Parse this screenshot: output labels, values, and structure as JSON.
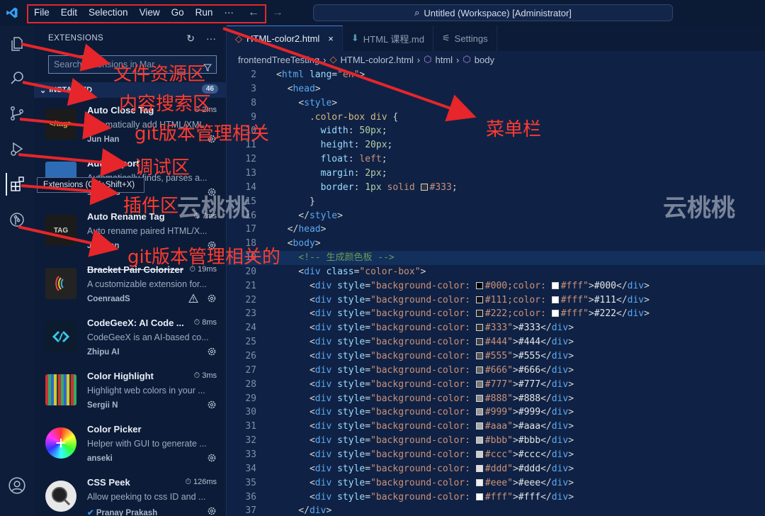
{
  "window": {
    "menu": [
      "File",
      "Edit",
      "Selection",
      "View",
      "Go",
      "Run",
      "···"
    ],
    "command_center": "Untitled (Workspace) [Administrator]"
  },
  "sidebar": {
    "title": "EXTENSIONS",
    "search_placeholder": "Search Extensions in Mar",
    "section_label": "INSTALLED",
    "section_count": "46",
    "tooltip": "Extensions (Ctrl+Shift+X)",
    "extensions": [
      {
        "name": "Auto Close Tag",
        "time": "2ms",
        "desc": "Automatically add HTML/XML",
        "author": "Jun Han",
        "icon_text": "</tag>",
        "icon_color": "#1a1a1a"
      },
      {
        "name": "Auto Import",
        "time": "",
        "desc": "Automatically finds, parses a...",
        "author": "steoates",
        "icon_text": "",
        "icon_color": "#2d6bb5"
      },
      {
        "name": "Auto Rename Tag",
        "time": "7ms",
        "desc": "Auto rename paired HTML/X...",
        "author": "Jun Han",
        "icon_text": "TAG",
        "icon_color": "#1a1a1a"
      },
      {
        "name": "Bracket Pair Colorizer",
        "time": "19ms",
        "desc": "A customizable extension for...",
        "author": "CoenraadS",
        "icon_text": "",
        "icon_color": "#222"
      },
      {
        "name": "CodeGeeX: AI Code ...",
        "time": "8ms",
        "desc": "CodeGeeX is an AI-based co...",
        "author": "Zhipu AI",
        "icon_text": "",
        "icon_color": "#0d1b2e"
      },
      {
        "name": "Color Highlight",
        "time": "3ms",
        "desc": "Highlight web colors in your ...",
        "author": "Sergii N",
        "icon_text": "",
        "icon_color": "#333"
      },
      {
        "name": "Color Picker",
        "time": "",
        "desc": "Helper with GUI to generate ...",
        "author": "anseki",
        "icon_text": "",
        "icon_color": "#fff"
      },
      {
        "name": "CSS Peek",
        "time": "126ms",
        "desc": "Allow peeking to css ID and ...",
        "author": "Pranay Prakash",
        "icon_text": "",
        "icon_color": "#eee"
      }
    ]
  },
  "tabs": [
    {
      "label": "HTML-color2.html",
      "active": true
    },
    {
      "label": "HTML 课程.md",
      "active": false
    },
    {
      "label": "Settings",
      "active": false
    }
  ],
  "breadcrumb": [
    "frontendTreeTesting",
    "HTML-color2.html",
    "html",
    "body"
  ],
  "annotations": {
    "menu_bar": "菜单栏",
    "explorer": "文件资源区",
    "search": "内容搜索区",
    "git": "git版本管理相关",
    "debug": "调试区",
    "extensions": "插件区",
    "git2": "git版本管理相关的",
    "watermark": "云桃桃"
  },
  "code_lines": [
    {
      "n": "2",
      "parts": [
        [
          "t-pun",
          "<"
        ],
        [
          "t-tag",
          "html "
        ],
        [
          "t-attr",
          "lang"
        ],
        [
          "t-pun",
          "="
        ],
        [
          "t-str",
          "\"en\""
        ],
        [
          "t-pun",
          ">"
        ]
      ]
    },
    {
      "n": "3",
      "parts": [
        [
          "t-pun",
          "  <"
        ],
        [
          "t-tag",
          "head"
        ],
        [
          "t-pun",
          ">"
        ]
      ]
    },
    {
      "n": "8",
      "parts": [
        [
          "t-pun",
          "    <"
        ],
        [
          "t-tag",
          "style"
        ],
        [
          "t-pun",
          ">"
        ]
      ]
    },
    {
      "n": "9",
      "parts": [
        [
          "t-sel",
          "      .color-box div "
        ],
        [
          "t-pun",
          "{"
        ]
      ]
    },
    {
      "n": "10",
      "parts": [
        [
          "t-prop",
          "        width"
        ],
        [
          "t-pun",
          ": "
        ],
        [
          "t-num",
          "50px"
        ],
        [
          "t-pun",
          ";"
        ]
      ]
    },
    {
      "n": "11",
      "parts": [
        [
          "t-prop",
          "        height"
        ],
        [
          "t-pun",
          ": "
        ],
        [
          "t-num",
          "20px"
        ],
        [
          "t-pun",
          ";"
        ]
      ]
    },
    {
      "n": "12",
      "parts": [
        [
          "t-prop",
          "        float"
        ],
        [
          "t-pun",
          ": "
        ],
        [
          "t-val",
          "left"
        ],
        [
          "t-pun",
          ";"
        ]
      ]
    },
    {
      "n": "13",
      "parts": [
        [
          "t-prop",
          "        margin"
        ],
        [
          "t-pun",
          ": "
        ],
        [
          "t-num",
          "2px"
        ],
        [
          "t-pun",
          ";"
        ]
      ]
    },
    {
      "n": "14",
      "parts": [
        [
          "t-prop",
          "        border"
        ],
        [
          "t-pun",
          ": "
        ],
        [
          "t-num",
          "1px "
        ],
        [
          "t-val",
          "solid "
        ],
        [
          "sw",
          "#333"
        ],
        [
          "t-val",
          "#333"
        ],
        [
          "t-pun",
          ";"
        ]
      ]
    },
    {
      "n": "15",
      "parts": [
        [
          "t-pun",
          "      }"
        ]
      ]
    },
    {
      "n": "16",
      "parts": [
        [
          "t-pun",
          "    </"
        ],
        [
          "t-tag",
          "style"
        ],
        [
          "t-pun",
          ">"
        ]
      ]
    },
    {
      "n": "17",
      "parts": [
        [
          "t-pun",
          "  </"
        ],
        [
          "t-tag",
          "head"
        ],
        [
          "t-pun",
          ">"
        ]
      ]
    },
    {
      "n": "18",
      "parts": [
        [
          "t-pun",
          "  <"
        ],
        [
          "t-tag",
          "body"
        ],
        [
          "t-pun",
          ">"
        ]
      ]
    },
    {
      "n": "19",
      "hl": true,
      "parts": [
        [
          "t-com",
          "    <!-- 生成颜色板 -->"
        ]
      ]
    },
    {
      "n": "20",
      "parts": [
        [
          "t-pun",
          "    <"
        ],
        [
          "t-tag",
          "div "
        ],
        [
          "t-attr",
          "class"
        ],
        [
          "t-pun",
          "="
        ],
        [
          "t-str",
          "\"color-box\""
        ],
        [
          "t-pun",
          ">"
        ]
      ]
    },
    {
      "n": "21",
      "parts": [
        [
          "t-pun",
          "      <"
        ],
        [
          "t-tag",
          "div "
        ],
        [
          "t-attr",
          "style"
        ],
        [
          "t-pun",
          "="
        ],
        [
          "t-str",
          "\"background-color: "
        ],
        [
          "sw",
          "#000"
        ],
        [
          "t-str",
          "#000;color: "
        ],
        [
          "sw",
          "#fff"
        ],
        [
          "t-str",
          "#fff\""
        ],
        [
          "t-pun",
          ">"
        ],
        [
          "t-txt",
          "#000"
        ],
        [
          "t-pun",
          "</"
        ],
        [
          "t-tag",
          "div"
        ],
        [
          "t-pun",
          ">"
        ]
      ]
    },
    {
      "n": "22",
      "parts": [
        [
          "t-pun",
          "      <"
        ],
        [
          "t-tag",
          "div "
        ],
        [
          "t-attr",
          "style"
        ],
        [
          "t-pun",
          "="
        ],
        [
          "t-str",
          "\"background-color: "
        ],
        [
          "sw",
          "#111"
        ],
        [
          "t-str",
          "#111;color: "
        ],
        [
          "sw",
          "#fff"
        ],
        [
          "t-str",
          "#fff\""
        ],
        [
          "t-pun",
          ">"
        ],
        [
          "t-txt",
          "#111"
        ],
        [
          "t-pun",
          "</"
        ],
        [
          "t-tag",
          "div"
        ],
        [
          "t-pun",
          ">"
        ]
      ]
    },
    {
      "n": "23",
      "parts": [
        [
          "t-pun",
          "      <"
        ],
        [
          "t-tag",
          "div "
        ],
        [
          "t-attr",
          "style"
        ],
        [
          "t-pun",
          "="
        ],
        [
          "t-str",
          "\"background-color: "
        ],
        [
          "sw",
          "#222"
        ],
        [
          "t-str",
          "#222;color: "
        ],
        [
          "sw",
          "#fff"
        ],
        [
          "t-str",
          "#fff\""
        ],
        [
          "t-pun",
          ">"
        ],
        [
          "t-txt",
          "#222"
        ],
        [
          "t-pun",
          "</"
        ],
        [
          "t-tag",
          "div"
        ],
        [
          "t-pun",
          ">"
        ]
      ]
    },
    {
      "n": "24",
      "parts": [
        [
          "t-pun",
          "      <"
        ],
        [
          "t-tag",
          "div "
        ],
        [
          "t-attr",
          "style"
        ],
        [
          "t-pun",
          "="
        ],
        [
          "t-str",
          "\"background-color: "
        ],
        [
          "sw",
          "#333"
        ],
        [
          "t-str",
          "#333\""
        ],
        [
          "t-pun",
          ">"
        ],
        [
          "t-txt",
          "#333"
        ],
        [
          "t-pun",
          "</"
        ],
        [
          "t-tag",
          "div"
        ],
        [
          "t-pun",
          ">"
        ]
      ]
    },
    {
      "n": "25",
      "parts": [
        [
          "t-pun",
          "      <"
        ],
        [
          "t-tag",
          "div "
        ],
        [
          "t-attr",
          "style"
        ],
        [
          "t-pun",
          "="
        ],
        [
          "t-str",
          "\"background-color: "
        ],
        [
          "sw",
          "#444"
        ],
        [
          "t-str",
          "#444\""
        ],
        [
          "t-pun",
          ">"
        ],
        [
          "t-txt",
          "#444"
        ],
        [
          "t-pun",
          "</"
        ],
        [
          "t-tag",
          "div"
        ],
        [
          "t-pun",
          ">"
        ]
      ]
    },
    {
      "n": "26",
      "parts": [
        [
          "t-pun",
          "      <"
        ],
        [
          "t-tag",
          "div "
        ],
        [
          "t-attr",
          "style"
        ],
        [
          "t-pun",
          "="
        ],
        [
          "t-str",
          "\"background-color: "
        ],
        [
          "sw",
          "#555"
        ],
        [
          "t-str",
          "#555\""
        ],
        [
          "t-pun",
          ">"
        ],
        [
          "t-txt",
          "#555"
        ],
        [
          "t-pun",
          "</"
        ],
        [
          "t-tag",
          "div"
        ],
        [
          "t-pun",
          ">"
        ]
      ]
    },
    {
      "n": "27",
      "parts": [
        [
          "t-pun",
          "      <"
        ],
        [
          "t-tag",
          "div "
        ],
        [
          "t-attr",
          "style"
        ],
        [
          "t-pun",
          "="
        ],
        [
          "t-str",
          "\"background-color: "
        ],
        [
          "sw",
          "#666"
        ],
        [
          "t-str",
          "#666\""
        ],
        [
          "t-pun",
          ">"
        ],
        [
          "t-txt",
          "#666"
        ],
        [
          "t-pun",
          "</"
        ],
        [
          "t-tag",
          "div"
        ],
        [
          "t-pun",
          ">"
        ]
      ]
    },
    {
      "n": "28",
      "parts": [
        [
          "t-pun",
          "      <"
        ],
        [
          "t-tag",
          "div "
        ],
        [
          "t-attr",
          "style"
        ],
        [
          "t-pun",
          "="
        ],
        [
          "t-str",
          "\"background-color: "
        ],
        [
          "sw",
          "#777"
        ],
        [
          "t-str",
          "#777\""
        ],
        [
          "t-pun",
          ">"
        ],
        [
          "t-txt",
          "#777"
        ],
        [
          "t-pun",
          "</"
        ],
        [
          "t-tag",
          "div"
        ],
        [
          "t-pun",
          ">"
        ]
      ]
    },
    {
      "n": "29",
      "parts": [
        [
          "t-pun",
          "      <"
        ],
        [
          "t-tag",
          "div "
        ],
        [
          "t-attr",
          "style"
        ],
        [
          "t-pun",
          "="
        ],
        [
          "t-str",
          "\"background-color: "
        ],
        [
          "sw",
          "#888"
        ],
        [
          "t-str",
          "#888\""
        ],
        [
          "t-pun",
          ">"
        ],
        [
          "t-txt",
          "#888"
        ],
        [
          "t-pun",
          "</"
        ],
        [
          "t-tag",
          "div"
        ],
        [
          "t-pun",
          ">"
        ]
      ]
    },
    {
      "n": "30",
      "parts": [
        [
          "t-pun",
          "      <"
        ],
        [
          "t-tag",
          "div "
        ],
        [
          "t-attr",
          "style"
        ],
        [
          "t-pun",
          "="
        ],
        [
          "t-str",
          "\"background-color: "
        ],
        [
          "sw",
          "#999"
        ],
        [
          "t-str",
          "#999\""
        ],
        [
          "t-pun",
          ">"
        ],
        [
          "t-txt",
          "#999"
        ],
        [
          "t-pun",
          "</"
        ],
        [
          "t-tag",
          "div"
        ],
        [
          "t-pun",
          ">"
        ]
      ]
    },
    {
      "n": "31",
      "parts": [
        [
          "t-pun",
          "      <"
        ],
        [
          "t-tag",
          "div "
        ],
        [
          "t-attr",
          "style"
        ],
        [
          "t-pun",
          "="
        ],
        [
          "t-str",
          "\"background-color: "
        ],
        [
          "sw",
          "#aaa"
        ],
        [
          "t-str",
          "#aaa\""
        ],
        [
          "t-pun",
          ">"
        ],
        [
          "t-txt",
          "#aaa"
        ],
        [
          "t-pun",
          "</"
        ],
        [
          "t-tag",
          "div"
        ],
        [
          "t-pun",
          ">"
        ]
      ]
    },
    {
      "n": "32",
      "parts": [
        [
          "t-pun",
          "      <"
        ],
        [
          "t-tag",
          "div "
        ],
        [
          "t-attr",
          "style"
        ],
        [
          "t-pun",
          "="
        ],
        [
          "t-str",
          "\"background-color: "
        ],
        [
          "sw",
          "#bbb"
        ],
        [
          "t-str",
          "#bbb\""
        ],
        [
          "t-pun",
          ">"
        ],
        [
          "t-txt",
          "#bbb"
        ],
        [
          "t-pun",
          "</"
        ],
        [
          "t-tag",
          "div"
        ],
        [
          "t-pun",
          ">"
        ]
      ]
    },
    {
      "n": "33",
      "parts": [
        [
          "t-pun",
          "      <"
        ],
        [
          "t-tag",
          "div "
        ],
        [
          "t-attr",
          "style"
        ],
        [
          "t-pun",
          "="
        ],
        [
          "t-str",
          "\"background-color: "
        ],
        [
          "sw",
          "#ccc"
        ],
        [
          "t-str",
          "#ccc\""
        ],
        [
          "t-pun",
          ">"
        ],
        [
          "t-txt",
          "#ccc"
        ],
        [
          "t-pun",
          "</"
        ],
        [
          "t-tag",
          "div"
        ],
        [
          "t-pun",
          ">"
        ]
      ]
    },
    {
      "n": "34",
      "parts": [
        [
          "t-pun",
          "      <"
        ],
        [
          "t-tag",
          "div "
        ],
        [
          "t-attr",
          "style"
        ],
        [
          "t-pun",
          "="
        ],
        [
          "t-str",
          "\"background-color: "
        ],
        [
          "sw",
          "#ddd"
        ],
        [
          "t-str",
          "#ddd\""
        ],
        [
          "t-pun",
          ">"
        ],
        [
          "t-txt",
          "#ddd"
        ],
        [
          "t-pun",
          "</"
        ],
        [
          "t-tag",
          "div"
        ],
        [
          "t-pun",
          ">"
        ]
      ]
    },
    {
      "n": "35",
      "parts": [
        [
          "t-pun",
          "      <"
        ],
        [
          "t-tag",
          "div "
        ],
        [
          "t-attr",
          "style"
        ],
        [
          "t-pun",
          "="
        ],
        [
          "t-str",
          "\"background-color: "
        ],
        [
          "sw",
          "#eee"
        ],
        [
          "t-str",
          "#eee\""
        ],
        [
          "t-pun",
          ">"
        ],
        [
          "t-txt",
          "#eee"
        ],
        [
          "t-pun",
          "</"
        ],
        [
          "t-tag",
          "div"
        ],
        [
          "t-pun",
          ">"
        ]
      ]
    },
    {
      "n": "36",
      "parts": [
        [
          "t-pun",
          "      <"
        ],
        [
          "t-tag",
          "div "
        ],
        [
          "t-attr",
          "style"
        ],
        [
          "t-pun",
          "="
        ],
        [
          "t-str",
          "\"background-color: "
        ],
        [
          "sw",
          "#fff"
        ],
        [
          "t-str",
          "#fff\""
        ],
        [
          "t-pun",
          ">"
        ],
        [
          "t-txt",
          "#fff"
        ],
        [
          "t-pun",
          "</"
        ],
        [
          "t-tag",
          "div"
        ],
        [
          "t-pun",
          ">"
        ]
      ]
    },
    {
      "n": "37",
      "parts": [
        [
          "t-pun",
          "    </"
        ],
        [
          "t-tag",
          "div"
        ],
        [
          "t-pun",
          ">"
        ]
      ]
    }
  ]
}
